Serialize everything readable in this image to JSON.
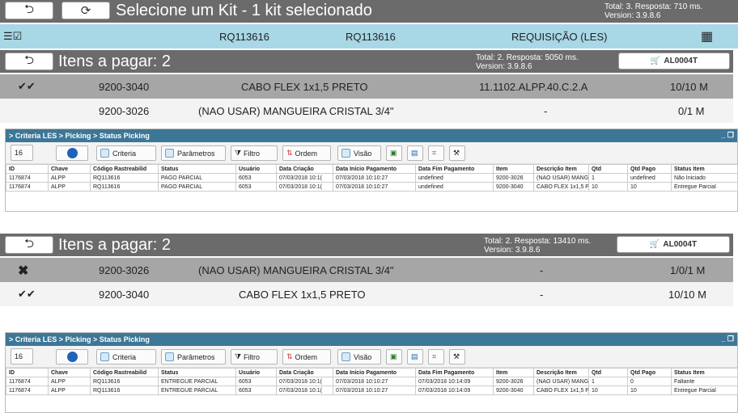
{
  "top": {
    "title": "Selecione um Kit - 1 kit selecionado",
    "total": "Total: 3. Resposta: 710 ms.",
    "version": "Version: 3.9.8.6"
  },
  "info": {
    "col1": "RQ113616",
    "col2": "RQ113616",
    "col3": "REQUISIÇÃO (LES)"
  },
  "sec1": {
    "title": "Itens a pagar: 2",
    "total": "Total: 2. Resposta: 5050 ms.",
    "version": "Version: 3.9.8.6",
    "cart": "AL0004T",
    "rows": [
      {
        "code": "9200-3040",
        "desc": "CABO FLEX 1x1,5 PRETO",
        "loc": "11.1102.ALPP.40.C.2.A",
        "qty": "10/10 M"
      },
      {
        "code": "9200-3026",
        "desc": "(NAO USAR) MANGUEIRA CRISTAL 3/4\"",
        "loc": "-",
        "qty": "0/1 M"
      }
    ]
  },
  "panel1": {
    "title": "> Criteria LES > Picking > Status Picking",
    "page": "16",
    "toolbar": {
      "criteria": "Criteria",
      "params": "Parâmetros",
      "filter": "Filtro",
      "order": "Ordem",
      "view": "Visão"
    },
    "headers": [
      "ID",
      "Chave",
      "Código Rastreabilid",
      "Status",
      "Usuário",
      "Data Criação",
      "Data Início Pagamento",
      "Data Fim Pagamento",
      "Item",
      "Descrição Item",
      "Qtd",
      "Qtd Pago",
      "Status Item"
    ],
    "rows": [
      [
        "1176874",
        "ALPP",
        "RQ113616",
        "PAGO PARCIAL",
        "6053",
        "07/03/2018 10:1(",
        "07/03/2018 10:10:27",
        "undefined",
        "9200-3026",
        "(NAO USAR) MANGU",
        "1",
        "undefined",
        "Não Iniciado"
      ],
      [
        "1176874",
        "ALPP",
        "RQ113616",
        "PAGO PARCIAL",
        "6053",
        "07/03/2018 10:1(",
        "07/03/2018 10:10:27",
        "undefined",
        "9200-3040",
        "CABO FLEX 1x1,5 P",
        "10",
        "10",
        "Entregue Parcial"
      ]
    ]
  },
  "sec2": {
    "title": "Itens a pagar: 2",
    "total": "Total: 2. Resposta: 13410 ms.",
    "version": "Version: 3.9.8.6",
    "cart": "AL0004T",
    "rows": [
      {
        "code": "9200-3026",
        "desc": "(NAO USAR) MANGUEIRA CRISTAL 3/4\"",
        "loc": "-",
        "qty": "1/0/1 M"
      },
      {
        "code": "9200-3040",
        "desc": "CABO FLEX 1x1,5 PRETO",
        "loc": "-",
        "qty": "10/10 M"
      }
    ]
  },
  "panel2": {
    "title": "> Criteria LES > Picking > Status Picking",
    "page": "16",
    "toolbar": {
      "criteria": "Criteria",
      "params": "Parâmetros",
      "filter": "Filtro",
      "order": "Ordem",
      "view": "Visão"
    },
    "headers": [
      "ID",
      "Chave",
      "Código Rastreabilid",
      "Status",
      "Usuário",
      "Data Criação",
      "Data Início Pagamento",
      "Data Fim Pagamento",
      "Item",
      "Descrição Item",
      "Qtd",
      "Qtd Pago",
      "Status Item"
    ],
    "rows": [
      [
        "1176874",
        "ALPP",
        "RQ113616",
        "ENTREGUE PARCIAL",
        "6053",
        "07/03/2018 10:1(",
        "07/03/2018 10:10:27",
        "07/03/2018 10:14:09",
        "9200-3026",
        "(NAO USAR) MANGU",
        "1",
        "0",
        "Faltante"
      ],
      [
        "1176874",
        "ALPP",
        "RQ113616",
        "ENTREGUE PARCIAL",
        "6053",
        "07/03/2018 10:1(",
        "07/03/2018 10:10:27",
        "07/03/2018 10:14:09",
        "9200-3040",
        "CABO FLEX 1x1,5 P",
        "10",
        "10",
        "Entregue Parcial"
      ]
    ]
  }
}
